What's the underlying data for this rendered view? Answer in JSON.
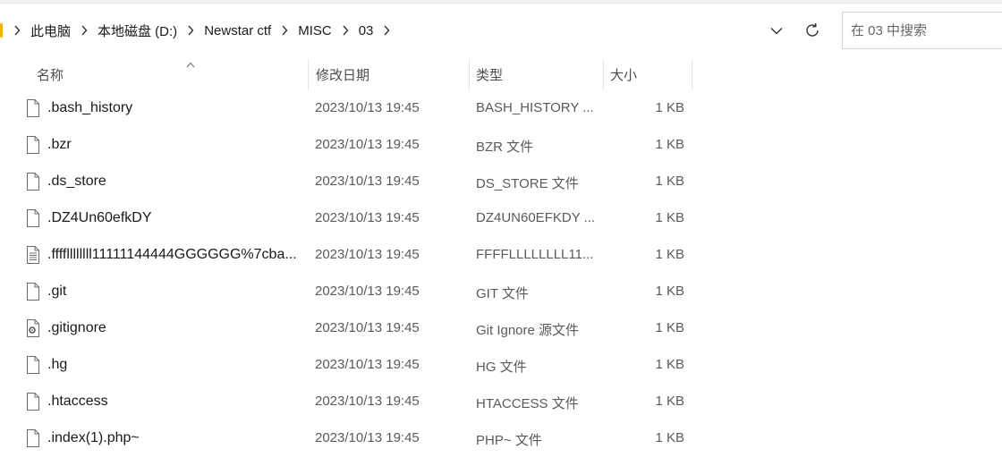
{
  "window": {
    "accent_color": "#f0b400"
  },
  "address_bar": {
    "breadcrumbs": [
      "此电脑",
      "本地磁盘 (D:)",
      "Newstar ctf",
      "MISC",
      "03"
    ],
    "history_icon": "chevron-down-icon",
    "refresh_icon": "refresh-icon"
  },
  "search": {
    "placeholder": "在 03 中搜索"
  },
  "columns": {
    "name": "名称",
    "date": "修改日期",
    "type": "类型",
    "size": "大小"
  },
  "files": [
    {
      "name": ".bash_history",
      "date": "2023/10/13 19:45",
      "type": "BASH_HISTORY ...",
      "size": "1 KB",
      "icon": "blank-file-icon"
    },
    {
      "name": ".bzr",
      "date": "2023/10/13 19:45",
      "type": "BZR 文件",
      "size": "1 KB",
      "icon": "blank-file-icon"
    },
    {
      "name": ".ds_store",
      "date": "2023/10/13 19:45",
      "type": "DS_STORE 文件",
      "size": "1 KB",
      "icon": "blank-file-icon"
    },
    {
      "name": ".DZ4Un60efkDY",
      "date": "2023/10/13 19:45",
      "type": "DZ4UN60EFKDY ...",
      "size": "1 KB",
      "icon": "blank-file-icon"
    },
    {
      "name": ".ffffllllllll11111144444GGGGGG%7cba...",
      "date": "2023/10/13 19:45",
      "type": "FFFFLLLLLLLL11...",
      "size": "1 KB",
      "icon": "text-file-icon"
    },
    {
      "name": ".git",
      "date": "2023/10/13 19:45",
      "type": "GIT 文件",
      "size": "1 KB",
      "icon": "blank-file-icon"
    },
    {
      "name": ".gitignore",
      "date": "2023/10/13 19:45",
      "type": "Git Ignore 源文件",
      "size": "1 KB",
      "icon": "config-file-icon"
    },
    {
      "name": ".hg",
      "date": "2023/10/13 19:45",
      "type": "HG 文件",
      "size": "1 KB",
      "icon": "blank-file-icon"
    },
    {
      "name": ".htaccess",
      "date": "2023/10/13 19:45",
      "type": "HTACCESS 文件",
      "size": "1 KB",
      "icon": "blank-file-icon"
    },
    {
      "name": ".index(1).php~",
      "date": "2023/10/13 19:45",
      "type": "PHP~ 文件",
      "size": "1 KB",
      "icon": "blank-file-icon"
    }
  ]
}
